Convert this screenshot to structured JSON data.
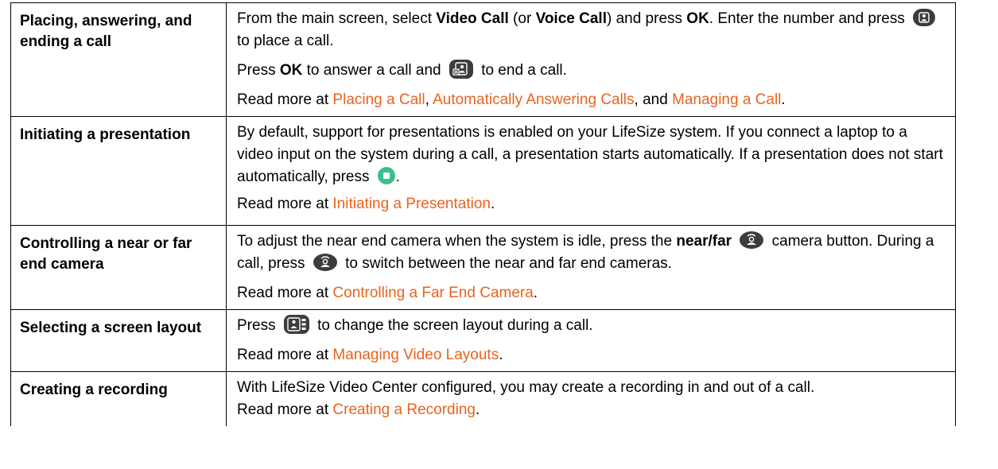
{
  "rows": [
    {
      "term": "Placing, answering, and ending a call",
      "p1": {
        "t1": "From the main screen, select ",
        "b1": "Video Call",
        "t2": " (or ",
        "b2": "Voice Call",
        "t3": ") and press ",
        "b3": "OK",
        "t4": ". Enter the number and press",
        "t5": "to place a call."
      },
      "p2": {
        "t1": "Press ",
        "b1": "OK",
        "t2": " to answer a call and",
        "t3": "to end a call."
      },
      "p3": {
        "t1": "Read more at ",
        "l1": "Placing a Call",
        "t2": ", ",
        "l2": "Automatically Answering Calls",
        "t3": ", and ",
        "l3": "Managing a Call",
        "t4": "."
      }
    },
    {
      "term": "Initiating a presentation",
      "p1": {
        "t1": "By default, support for presentations is enabled on your LifeSize system. If you connect a laptop to a video input on the system during a call, a presentation starts automatically. If a presentation does not start automatically, press",
        "t2": "."
      },
      "p2": {
        "t1": "Read more at ",
        "l1": "Initiating a Presentation",
        "t2": "."
      }
    },
    {
      "term": "Controlling a near or far end camera",
      "p1": {
        "t1": "To adjust the near end camera when the system is idle, press the ",
        "b1": "near/far",
        "t2": "camera button. During a call, press",
        "t3": "to switch between the near and far end cameras."
      },
      "p2": {
        "t1": "Read more at ",
        "l1": "Controlling a Far End Camera",
        "t2": "."
      }
    },
    {
      "term": "Selecting a screen layout",
      "p1": {
        "t1": "Press",
        "t2": "to change the screen layout during a call."
      },
      "p2": {
        "t1": "Read more at ",
        "l1": "Managing Video Layouts",
        "t2": "."
      }
    },
    {
      "term": "Creating a recording",
      "p1": {
        "t1": "With LifeSize Video Center configured, you may create a recording in and out of a call."
      },
      "p2": {
        "t1": "Read more at ",
        "l1": "Creating a Recording",
        "t2": "."
      }
    }
  ],
  "icons": {
    "call": "call-button-icon",
    "hangup": "hang-up-button-icon",
    "presentation": "presentation-button-icon",
    "nearfar": "near-far-camera-button-icon",
    "layout": "layout-button-icon"
  },
  "colors": {
    "link": "#e8641e",
    "text": "#000000",
    "border": "#000000",
    "button_dark": "#3c3c3c",
    "presentation_green": "#3dbf8a"
  }
}
